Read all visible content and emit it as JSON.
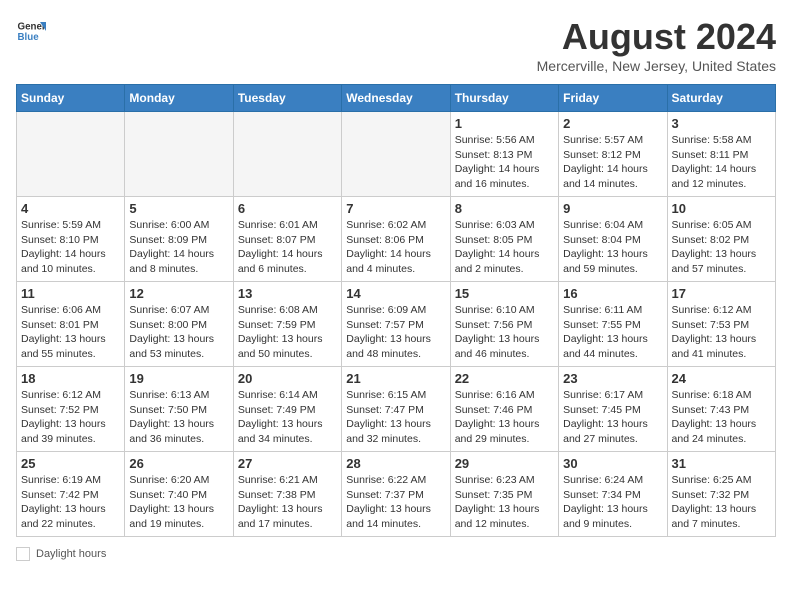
{
  "header": {
    "logo_text_general": "General",
    "logo_text_blue": "Blue",
    "month_title": "August 2024",
    "location": "Mercerville, New Jersey, United States"
  },
  "days_of_week": [
    "Sunday",
    "Monday",
    "Tuesday",
    "Wednesday",
    "Thursday",
    "Friday",
    "Saturday"
  ],
  "weeks": [
    [
      {
        "day": "",
        "info": ""
      },
      {
        "day": "",
        "info": ""
      },
      {
        "day": "",
        "info": ""
      },
      {
        "day": "",
        "info": ""
      },
      {
        "day": "1",
        "info": "Sunrise: 5:56 AM\nSunset: 8:13 PM\nDaylight: 14 hours and 16 minutes."
      },
      {
        "day": "2",
        "info": "Sunrise: 5:57 AM\nSunset: 8:12 PM\nDaylight: 14 hours and 14 minutes."
      },
      {
        "day": "3",
        "info": "Sunrise: 5:58 AM\nSunset: 8:11 PM\nDaylight: 14 hours and 12 minutes."
      }
    ],
    [
      {
        "day": "4",
        "info": "Sunrise: 5:59 AM\nSunset: 8:10 PM\nDaylight: 14 hours and 10 minutes."
      },
      {
        "day": "5",
        "info": "Sunrise: 6:00 AM\nSunset: 8:09 PM\nDaylight: 14 hours and 8 minutes."
      },
      {
        "day": "6",
        "info": "Sunrise: 6:01 AM\nSunset: 8:07 PM\nDaylight: 14 hours and 6 minutes."
      },
      {
        "day": "7",
        "info": "Sunrise: 6:02 AM\nSunset: 8:06 PM\nDaylight: 14 hours and 4 minutes."
      },
      {
        "day": "8",
        "info": "Sunrise: 6:03 AM\nSunset: 8:05 PM\nDaylight: 14 hours and 2 minutes."
      },
      {
        "day": "9",
        "info": "Sunrise: 6:04 AM\nSunset: 8:04 PM\nDaylight: 13 hours and 59 minutes."
      },
      {
        "day": "10",
        "info": "Sunrise: 6:05 AM\nSunset: 8:02 PM\nDaylight: 13 hours and 57 minutes."
      }
    ],
    [
      {
        "day": "11",
        "info": "Sunrise: 6:06 AM\nSunset: 8:01 PM\nDaylight: 13 hours and 55 minutes."
      },
      {
        "day": "12",
        "info": "Sunrise: 6:07 AM\nSunset: 8:00 PM\nDaylight: 13 hours and 53 minutes."
      },
      {
        "day": "13",
        "info": "Sunrise: 6:08 AM\nSunset: 7:59 PM\nDaylight: 13 hours and 50 minutes."
      },
      {
        "day": "14",
        "info": "Sunrise: 6:09 AM\nSunset: 7:57 PM\nDaylight: 13 hours and 48 minutes."
      },
      {
        "day": "15",
        "info": "Sunrise: 6:10 AM\nSunset: 7:56 PM\nDaylight: 13 hours and 46 minutes."
      },
      {
        "day": "16",
        "info": "Sunrise: 6:11 AM\nSunset: 7:55 PM\nDaylight: 13 hours and 44 minutes."
      },
      {
        "day": "17",
        "info": "Sunrise: 6:12 AM\nSunset: 7:53 PM\nDaylight: 13 hours and 41 minutes."
      }
    ],
    [
      {
        "day": "18",
        "info": "Sunrise: 6:12 AM\nSunset: 7:52 PM\nDaylight: 13 hours and 39 minutes."
      },
      {
        "day": "19",
        "info": "Sunrise: 6:13 AM\nSunset: 7:50 PM\nDaylight: 13 hours and 36 minutes."
      },
      {
        "day": "20",
        "info": "Sunrise: 6:14 AM\nSunset: 7:49 PM\nDaylight: 13 hours and 34 minutes."
      },
      {
        "day": "21",
        "info": "Sunrise: 6:15 AM\nSunset: 7:47 PM\nDaylight: 13 hours and 32 minutes."
      },
      {
        "day": "22",
        "info": "Sunrise: 6:16 AM\nSunset: 7:46 PM\nDaylight: 13 hours and 29 minutes."
      },
      {
        "day": "23",
        "info": "Sunrise: 6:17 AM\nSunset: 7:45 PM\nDaylight: 13 hours and 27 minutes."
      },
      {
        "day": "24",
        "info": "Sunrise: 6:18 AM\nSunset: 7:43 PM\nDaylight: 13 hours and 24 minutes."
      }
    ],
    [
      {
        "day": "25",
        "info": "Sunrise: 6:19 AM\nSunset: 7:42 PM\nDaylight: 13 hours and 22 minutes."
      },
      {
        "day": "26",
        "info": "Sunrise: 6:20 AM\nSunset: 7:40 PM\nDaylight: 13 hours and 19 minutes."
      },
      {
        "day": "27",
        "info": "Sunrise: 6:21 AM\nSunset: 7:38 PM\nDaylight: 13 hours and 17 minutes."
      },
      {
        "day": "28",
        "info": "Sunrise: 6:22 AM\nSunset: 7:37 PM\nDaylight: 13 hours and 14 minutes."
      },
      {
        "day": "29",
        "info": "Sunrise: 6:23 AM\nSunset: 7:35 PM\nDaylight: 13 hours and 12 minutes."
      },
      {
        "day": "30",
        "info": "Sunrise: 6:24 AM\nSunset: 7:34 PM\nDaylight: 13 hours and 9 minutes."
      },
      {
        "day": "31",
        "info": "Sunrise: 6:25 AM\nSunset: 7:32 PM\nDaylight: 13 hours and 7 minutes."
      }
    ]
  ],
  "footer": {
    "daylight_label": "Daylight hours"
  },
  "accent_color": "#3a7fc1"
}
